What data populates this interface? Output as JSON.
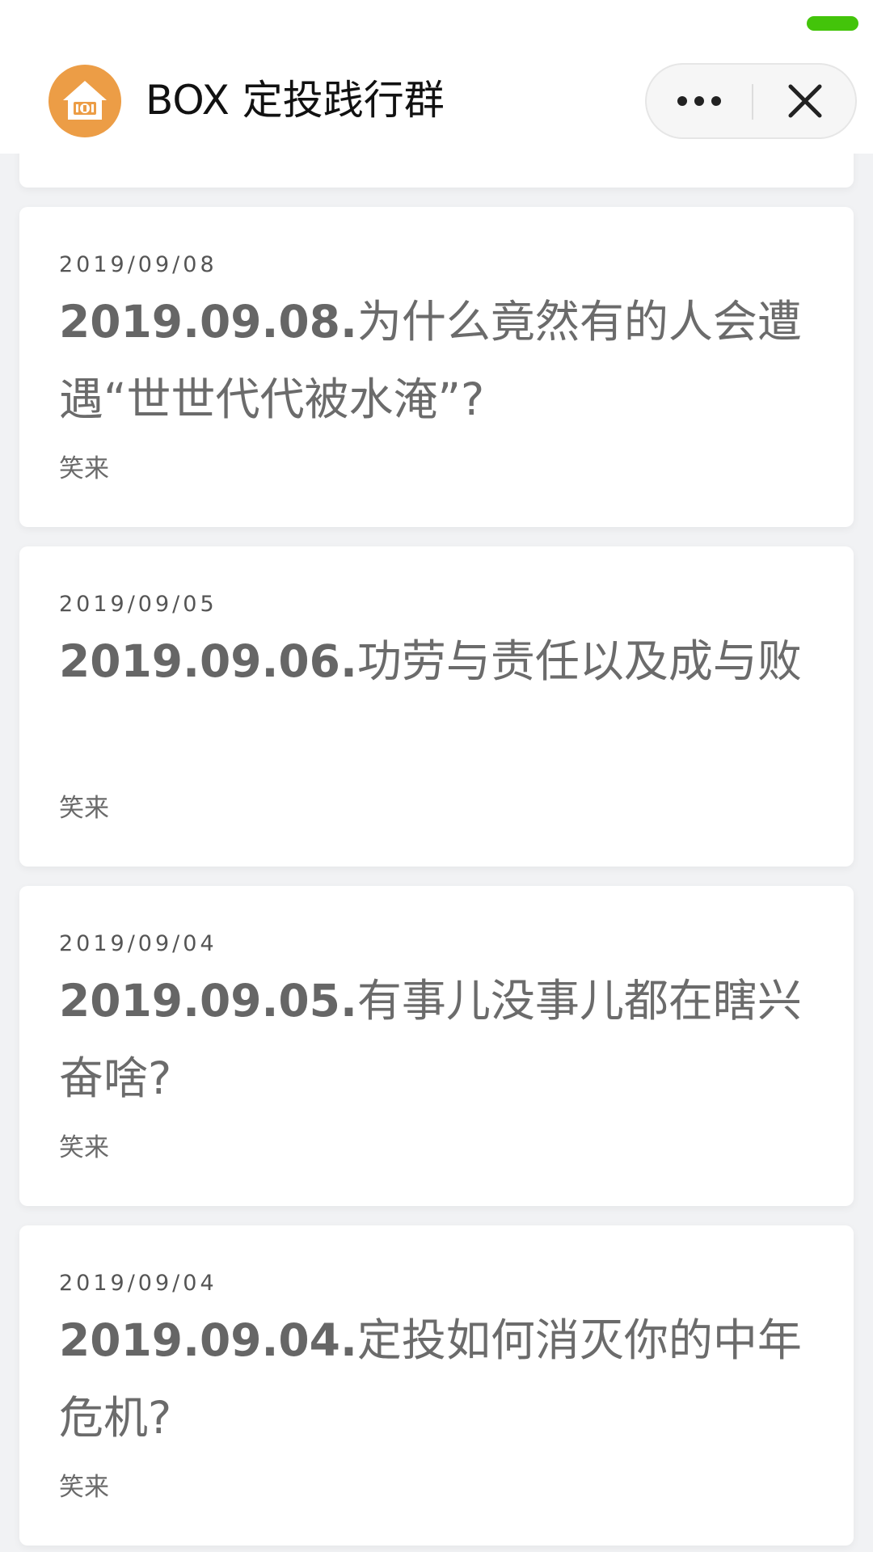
{
  "nav": {
    "title": "BOX 定投践行群",
    "logo_icon": "piggy-bank-house-icon",
    "more_icon": "more-dots-icon",
    "close_icon": "close-icon",
    "status_color": "#43c40a"
  },
  "articles": [
    {
      "date": "2019/09/08",
      "title_num": "2019.09.08.",
      "title_text": "为什么竟然有的人会遭遇“世世代代被水淹”?",
      "author": "笑来"
    },
    {
      "date": "2019/09/05",
      "title_num": "2019.09.06.",
      "title_text": "功劳与责任以及成与败",
      "author": "笑来"
    },
    {
      "date": "2019/09/04",
      "title_num": "2019.09.05.",
      "title_text": "有事儿没事儿都在瞎兴奋啥?",
      "author": "笑来"
    },
    {
      "date": "2019/09/04",
      "title_num": "2019.09.04.",
      "title_text": "定投如何消灭你的中年危机?",
      "author": "笑来"
    }
  ]
}
